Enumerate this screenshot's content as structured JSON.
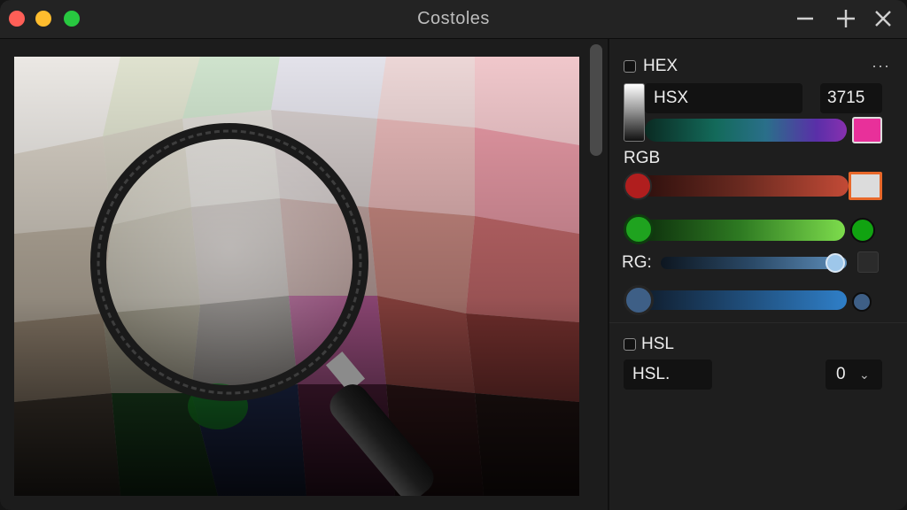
{
  "window": {
    "title": "Costoles"
  },
  "panel": {
    "hex_section": {
      "label": "HEX",
      "more": "···"
    },
    "hsx": {
      "label": "HSX",
      "value": "3715"
    },
    "rgb_section": {
      "label": "RGB"
    },
    "rg_row": {
      "label": "RG:"
    },
    "hsl_section": {
      "label": "HSL",
      "field": "HSL.",
      "dropdown_value": "0",
      "dropdown_chevron": "⌄"
    }
  },
  "sliders": {
    "hue": {
      "level": 0.95
    },
    "red": {
      "level": 0.02
    },
    "green": {
      "level": 0.02
    },
    "rg": {
      "level": 0.95
    },
    "blue": {
      "level": 0.02
    }
  },
  "colors": {
    "accent_pink": "#e8309a",
    "red_knob": "#b01e1e",
    "green_knob": "#1fa31f",
    "blue_knob": "#3e5f86",
    "rg_knob": "#9ec7ea",
    "orange_border": "#e8682a"
  },
  "icons": {
    "minimize": "minus-icon",
    "zoom": "plus-icon",
    "close": "close-icon",
    "loupe": "magnifying-glass-icon"
  }
}
